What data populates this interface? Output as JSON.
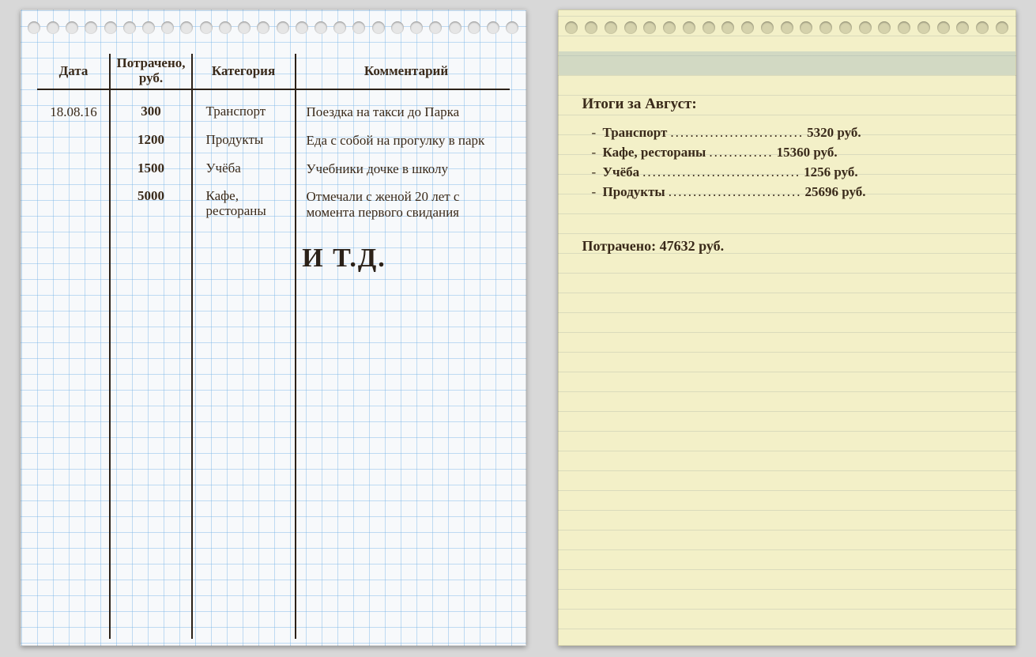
{
  "left": {
    "headers": {
      "date": "Дата",
      "spent": "Потрачено, руб.",
      "category": "Категория",
      "comment": "Комментарий"
    },
    "rows": [
      {
        "date": "18.08.16",
        "spent": "300",
        "category": "Транспорт",
        "comment": "Поездка на такси до Парка"
      },
      {
        "date": "",
        "spent": "1200",
        "category": "Продукты",
        "comment": "Еда с собой на прогулку в парк"
      },
      {
        "date": "",
        "spent": "1500",
        "category": "Учёба",
        "comment": "Учебники дочке в школу"
      },
      {
        "date": "",
        "spent": "5000",
        "category": "Кафе, рестораны",
        "comment": "Отмечали с женой 20 лет с момента первого свидания"
      }
    ],
    "etc": "И Т.Д."
  },
  "right": {
    "title": "Итоги за Август:",
    "items": [
      {
        "name": "Транспорт",
        "value": "5320 руб."
      },
      {
        "name": "Кафе, рестораны",
        "value": "15360 руб."
      },
      {
        "name": "Учёба",
        "value": "1256 руб."
      },
      {
        "name": "Продукты",
        "value": "25696 руб."
      }
    ],
    "total": "Потрачено: 47632 руб."
  }
}
